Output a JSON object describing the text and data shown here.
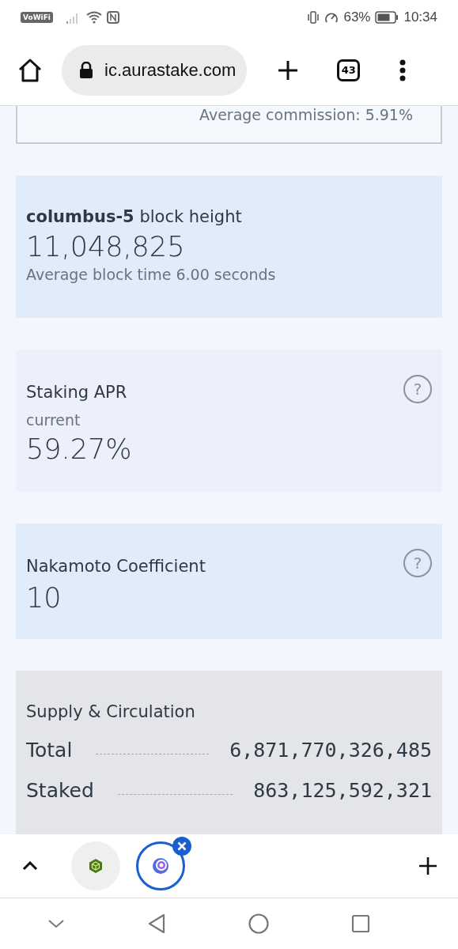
{
  "status_bar": {
    "left_badge": "VoWiFi",
    "battery_percent": "63%",
    "time": "10:34"
  },
  "browser": {
    "url": "ic.aurastake.com",
    "tab_count": "43"
  },
  "commission_card": {
    "text": "Average commission:  5.91%"
  },
  "block_card": {
    "chain": "columbus-5",
    "label": " block height",
    "value": "11,048,825",
    "subtitle": "Average block time 6.00 seconds"
  },
  "apr_card": {
    "title": "Staking APR",
    "help": "?",
    "sublabel": "current",
    "value": "59.27%"
  },
  "nakamoto_card": {
    "title": "Nakamoto Coefficient",
    "help": "?",
    "value": "10"
  },
  "supply_card": {
    "title": "Supply & Circulation",
    "rows": [
      {
        "label": "Total",
        "value": "6,871,770,326,485"
      },
      {
        "label": "Staked",
        "value": "863,125,592,321"
      }
    ]
  },
  "tab_tray": {
    "tabs": [
      {
        "kind": "cube",
        "selected": false
      },
      {
        "kind": "ring",
        "selected": true
      }
    ]
  }
}
